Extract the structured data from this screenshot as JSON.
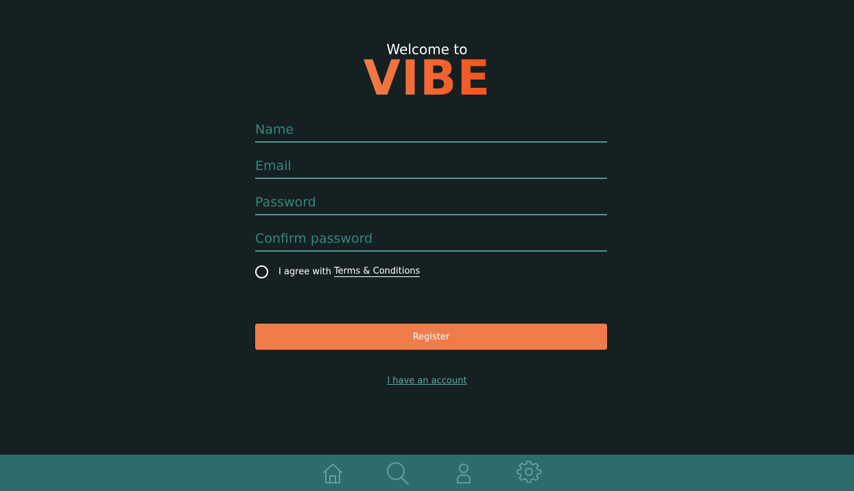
{
  "header": {
    "welcome": "Welcome to",
    "brand": "VIBE"
  },
  "form": {
    "name_placeholder": "Name",
    "email_placeholder": "Email",
    "password_placeholder": "Password",
    "confirm_placeholder": "Confirm password",
    "agree_text": "I agree with",
    "terms_link": "Terms & Conditions",
    "register_label": "Register",
    "account_link": "I have an account"
  },
  "nav": {
    "items": [
      "home-icon",
      "search-icon",
      "user-icon",
      "gear-icon"
    ]
  },
  "colors": {
    "background": "#142021",
    "accent": "#ef7c4b",
    "brand": "#f3531f",
    "field_line": "#4d9a93",
    "nav_bar": "#2e6b6b"
  }
}
